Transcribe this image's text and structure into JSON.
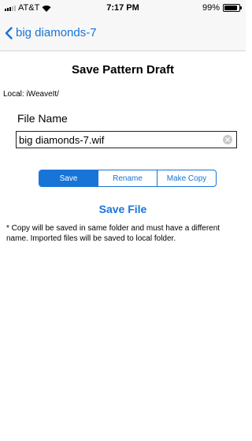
{
  "status_bar": {
    "carrier": "AT&T",
    "time": "7:17 PM",
    "battery_percent": "99%",
    "battery_level": 0.99
  },
  "nav": {
    "back_label": "big diamonds-7"
  },
  "page": {
    "title": "Save Pattern Draft",
    "local_path": "Local: iWeaveIt/",
    "file_name_label": "File Name",
    "file_name_value": "big diamonds-7.wif"
  },
  "segmented_control": {
    "options": [
      "Save",
      "Rename",
      "Make Copy"
    ],
    "selected": "Save"
  },
  "save_file_label": "Save File",
  "note": "* Copy will be saved in same folder and must have a different name. Imported files will be saved to local folder.",
  "colors": {
    "accent": "#1874d6",
    "bar_background": "#f7f7f7"
  }
}
